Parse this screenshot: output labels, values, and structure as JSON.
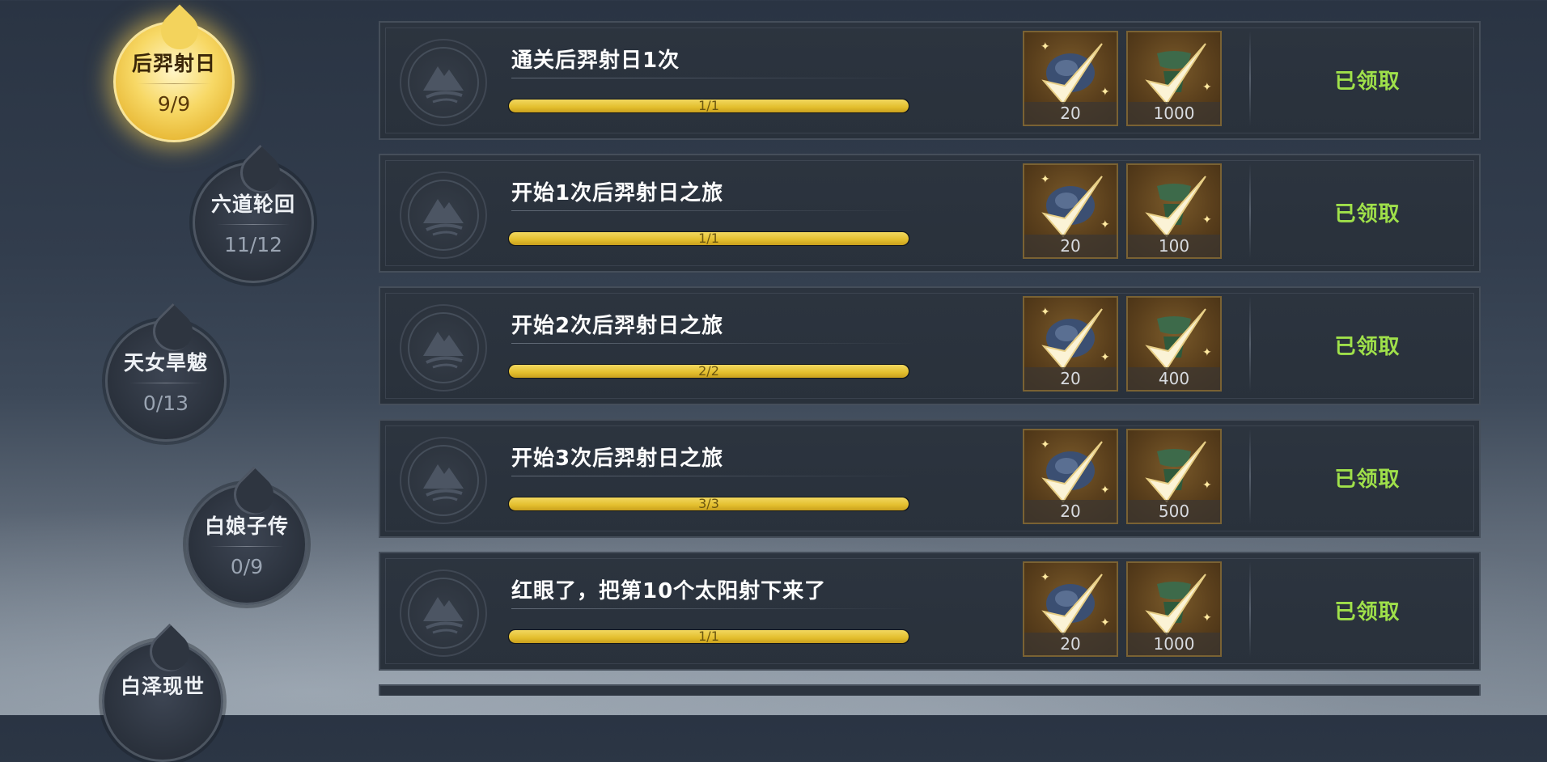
{
  "chapters": [
    {
      "name": "后羿射日",
      "count": "9/9",
      "state": "active"
    },
    {
      "name": "六道轮回",
      "count": "11/12",
      "state": "locked"
    },
    {
      "name": "天女旱魃",
      "count": "0/13",
      "state": "locked"
    },
    {
      "name": "白娘子传",
      "count": "0/9",
      "state": "locked"
    },
    {
      "name": "白泽现世",
      "count": "",
      "state": "locked"
    }
  ],
  "tasks": [
    {
      "title": "通关后羿射日1次",
      "progress_text": "1/1",
      "progress": 1.0,
      "rewards": [
        {
          "icon": "blue-orb-icon",
          "qty": "20"
        },
        {
          "icon": "green-jade-icon",
          "qty": "1000"
        }
      ],
      "status": "已领取"
    },
    {
      "title": "开始1次后羿射日之旅",
      "progress_text": "1/1",
      "progress": 1.0,
      "rewards": [
        {
          "icon": "blue-orb-icon",
          "qty": "20"
        },
        {
          "icon": "green-jade-icon",
          "qty": "100"
        }
      ],
      "status": "已领取"
    },
    {
      "title": "开始2次后羿射日之旅",
      "progress_text": "2/2",
      "progress": 1.0,
      "rewards": [
        {
          "icon": "blue-orb-icon",
          "qty": "20"
        },
        {
          "icon": "green-jade-icon",
          "qty": "400"
        }
      ],
      "status": "已领取"
    },
    {
      "title": "开始3次后羿射日之旅",
      "progress_text": "3/3",
      "progress": 1.0,
      "rewards": [
        {
          "icon": "blue-orb-icon",
          "qty": "20"
        },
        {
          "icon": "green-jade-icon",
          "qty": "500"
        }
      ],
      "status": "已领取"
    },
    {
      "title": "红眼了，把第10个太阳射下来了",
      "progress_text": "1/1",
      "progress": 1.0,
      "rewards": [
        {
          "icon": "blue-orb-icon",
          "qty": "20"
        },
        {
          "icon": "green-jade-icon",
          "qty": "1000"
        }
      ],
      "status": "已领取"
    }
  ],
  "colors": {
    "claimed": "#9fe04a",
    "progress_fill": "#e3be2d",
    "active_node": "#f7d865"
  }
}
